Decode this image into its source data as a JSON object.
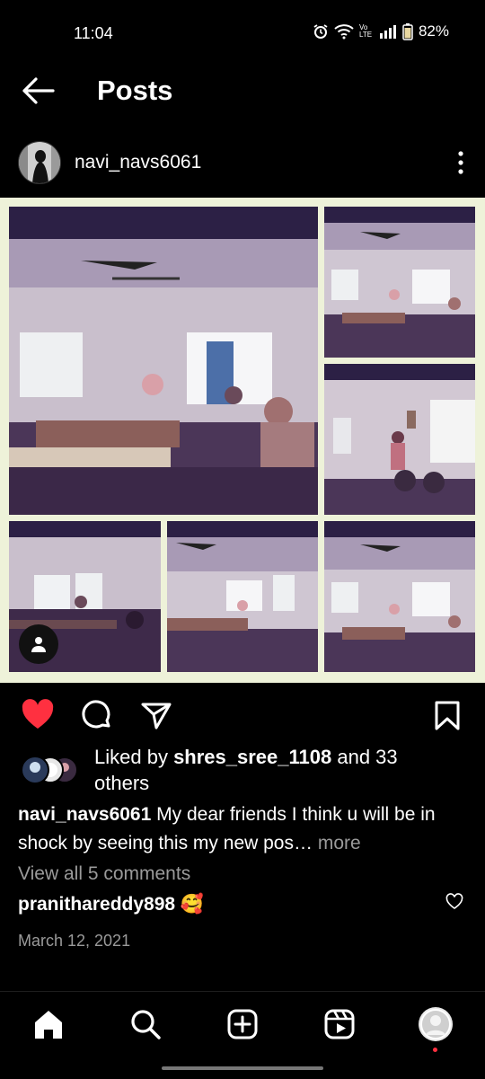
{
  "status": {
    "time": "11:04",
    "network_label": "Vo LTE",
    "battery": "82%"
  },
  "header": {
    "title": "Posts"
  },
  "post": {
    "username": "navi_navs6061",
    "actions": {
      "liked": true
    },
    "likes": {
      "prefix": "Liked by ",
      "user": "shres_sree_1108",
      "suffix": " and 33 others"
    },
    "caption": {
      "username": "navi_navs6061",
      "text": " My dear friends  I think u will be in shock by seeing this my new pos",
      "ellipsis": "… ",
      "more": "more"
    },
    "view_comments": "View all 5 comments",
    "comment": {
      "username": "pranithareddy898",
      "emoji": "🥰"
    },
    "date": "March 12, 2021"
  },
  "icons": {
    "back": "arrow-left-icon",
    "more": "kebab-icon",
    "like": "heart-filled-icon",
    "comment": "comment-icon",
    "share": "send-icon",
    "save": "bookmark-icon",
    "tag": "person-icon",
    "home": "home-icon",
    "search": "search-icon",
    "create": "plus-square-icon",
    "reels": "reels-icon",
    "profile": "profile-icon"
  },
  "colors": {
    "like_red": "#ff3040",
    "muted_text": "#9a9a9a",
    "collage_border": "#eef2d9"
  }
}
